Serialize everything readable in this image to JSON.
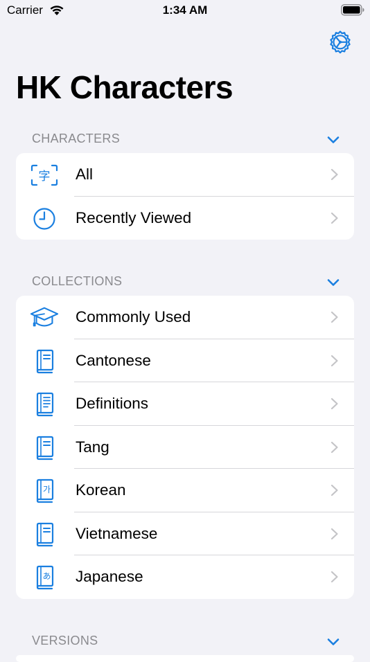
{
  "status_bar": {
    "carrier": "Carrier",
    "time": "1:34 AM"
  },
  "accent_color": "#1a7fe0",
  "title": "HK Characters",
  "sections": [
    {
      "header": "CHARACTERS",
      "rows": [
        {
          "label": "All",
          "icon": "character-viewfinder-icon"
        },
        {
          "label": "Recently Viewed",
          "icon": "clock-icon"
        }
      ]
    },
    {
      "header": "COLLECTIONS",
      "rows": [
        {
          "label": "Commonly Used",
          "icon": "graduation-cap-icon"
        },
        {
          "label": "Cantonese",
          "icon": "book-icon"
        },
        {
          "label": "Definitions",
          "icon": "book-pages-icon"
        },
        {
          "label": "Tang",
          "icon": "book-icon"
        },
        {
          "label": "Korean",
          "icon": "book-korean-icon",
          "glyph": "가"
        },
        {
          "label": "Vietnamese",
          "icon": "book-icon"
        },
        {
          "label": "Japanese",
          "icon": "book-japanese-icon",
          "glyph": "あ"
        }
      ]
    },
    {
      "header": "VERSIONS",
      "rows": []
    }
  ],
  "char_icon_glyph": "字"
}
